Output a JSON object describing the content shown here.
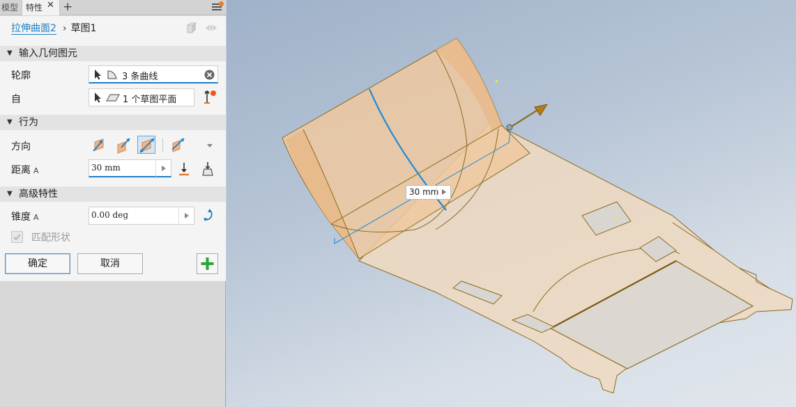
{
  "tabs": {
    "model": "模型",
    "properties": "特性"
  },
  "breadcrumb": {
    "feature": "拉伸曲面2",
    "separator": "›",
    "sketch": "草图1"
  },
  "sections": {
    "input_geometry": "输入几何图元",
    "behavior": "行为",
    "advanced": "高级特性"
  },
  "profile": {
    "label": "轮廓",
    "value": "3 条曲线"
  },
  "from": {
    "label": "自",
    "value": "1 个草图平面"
  },
  "direction": {
    "label": "方向"
  },
  "distance": {
    "label": "距离",
    "suffix": "A",
    "value": "30 mm"
  },
  "taper": {
    "label": "锥度",
    "suffix": "A",
    "value": "0.00 deg"
  },
  "match_shape": {
    "label": "匹配形状",
    "checked": true,
    "enabled": false
  },
  "buttons": {
    "ok": "确定",
    "cancel": "取消"
  },
  "viewport": {
    "dimension_value": "30 mm"
  },
  "colors": {
    "accent": "#1b7fc4",
    "surface": "#efc9a0",
    "edge": "#8a6a1f",
    "add_button": "#2aa43a",
    "notification": "#f07b22"
  }
}
